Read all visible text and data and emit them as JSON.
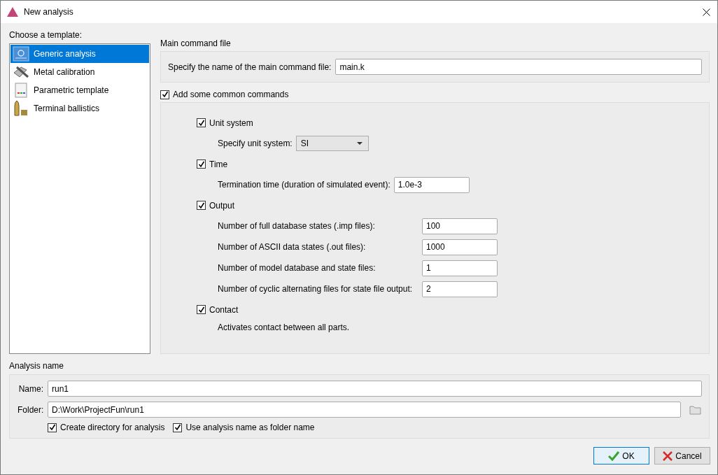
{
  "window": {
    "title": "New analysis"
  },
  "templates": {
    "label": "Choose a template:",
    "items": [
      {
        "label": "Generic analysis",
        "kind": "generic",
        "selected": true
      },
      {
        "label": "Metal calibration",
        "kind": "metal",
        "selected": false
      },
      {
        "label": "Parametric template",
        "kind": "parametric",
        "selected": false
      },
      {
        "label": "Terminal ballistics",
        "kind": "ballistics",
        "selected": false
      }
    ]
  },
  "main_command": {
    "heading": "Main command file",
    "label": "Specify the name of the main command file:",
    "value": "main.k"
  },
  "common_commands": {
    "label": "Add some common commands",
    "checked": true,
    "sections": [
      {
        "label": "Unit system",
        "checked": true,
        "rows": [
          {
            "kind": "select",
            "label": "Specify unit system:",
            "value": "SI"
          }
        ]
      },
      {
        "label": "Time",
        "checked": true,
        "rows": [
          {
            "kind": "field",
            "label": "Termination time (duration of simulated event):",
            "value": "1.0e-3"
          }
        ]
      },
      {
        "label": "Output",
        "checked": true,
        "rows": [
          {
            "kind": "aligned",
            "label": "Number of full database states (.imp files):",
            "value": "100"
          },
          {
            "kind": "aligned",
            "label": "Number of ASCII data states (.out files):",
            "value": "1000"
          },
          {
            "kind": "aligned",
            "label": "Number of model database and state files:",
            "value": "1"
          },
          {
            "kind": "aligned",
            "label": "Number of cyclic alternating files for state file output:",
            "value": "2"
          }
        ]
      },
      {
        "label": "Contact",
        "checked": true,
        "rows": [
          {
            "kind": "note",
            "label": "Activates contact between all parts."
          }
        ]
      }
    ]
  },
  "analysis_name": {
    "heading": "Analysis name",
    "name": {
      "label": "Name:",
      "value": "run1"
    },
    "folder": {
      "label": "Folder:",
      "value": "D:\\Work\\ProjectFun\\run1"
    },
    "options": [
      {
        "label": "Create directory for analysis",
        "checked": true
      },
      {
        "label": "Use analysis name as folder name",
        "checked": true
      }
    ]
  },
  "buttons": [
    {
      "label": "OK",
      "kind": "ok"
    },
    {
      "label": "Cancel",
      "kind": "cancel"
    }
  ]
}
